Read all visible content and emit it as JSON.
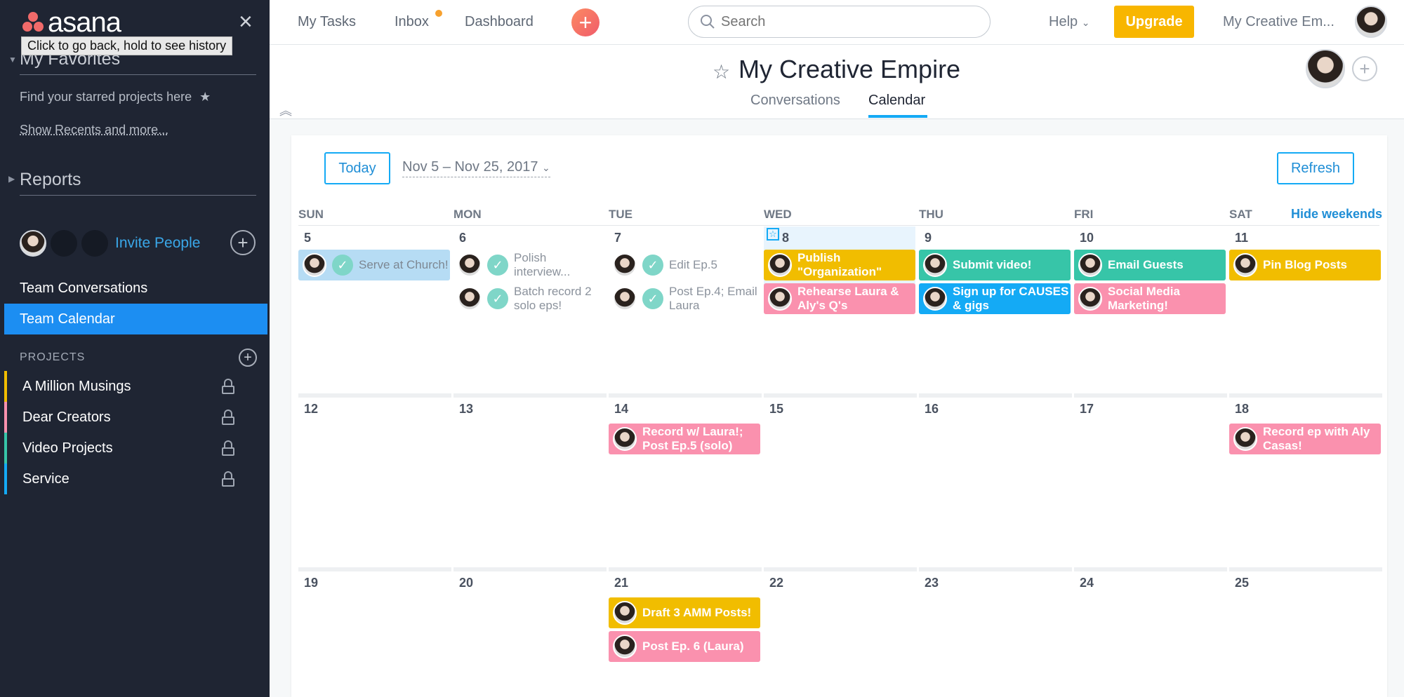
{
  "sidebar": {
    "logo_text": "asana",
    "tooltip": "Click to go back, hold to see history",
    "favorites_title": "My Favorites",
    "favorites_hint": "Find your starred projects here",
    "show_recents": "Show Recents and more...",
    "reports_title": "Reports",
    "invite_people": "Invite People",
    "nav": [
      {
        "label": "Team Conversations"
      },
      {
        "label": "Team Calendar"
      }
    ],
    "projects_title": "PROJECTS",
    "projects": [
      {
        "label": "A Million Musings",
        "color": "#f1bd00"
      },
      {
        "label": "Dear Creators",
        "color": "#fa91ae"
      },
      {
        "label": "Video Projects",
        "color": "#37c5a8"
      },
      {
        "label": "Service",
        "color": "#14aaf5"
      }
    ]
  },
  "topbar": {
    "my_tasks": "My Tasks",
    "inbox": "Inbox",
    "dashboard": "Dashboard",
    "search_placeholder": "Search",
    "help": "Help",
    "upgrade": "Upgrade",
    "workspace": "My Creative Em..."
  },
  "header": {
    "title": "My Creative Empire",
    "tabs": [
      {
        "label": "Conversations"
      },
      {
        "label": "Calendar"
      }
    ]
  },
  "calendar": {
    "today_label": "Today",
    "range_label": "Nov 5 – Nov 25, 2017",
    "refresh_label": "Refresh",
    "hide_weekends": "Hide weekends",
    "days_of_week": [
      "SUN",
      "MON",
      "TUE",
      "WED",
      "THU",
      "FRI",
      "SAT"
    ],
    "weeks": [
      [
        "5",
        "6",
        "7",
        "8",
        "9",
        "10",
        "11"
      ],
      [
        "12",
        "13",
        "14",
        "15",
        "16",
        "17",
        "18"
      ],
      [
        "19",
        "20",
        "21",
        "22",
        "23",
        "24",
        "25"
      ]
    ],
    "tasks": {
      "serve_church": "Serve at Church!",
      "polish_interview": "Polish interview...",
      "batch_record": "Batch record 2 solo eps!",
      "edit_ep5": "Edit Ep.5",
      "post_ep4": "Post Ep.4; Email Laura",
      "publish_org": "Publish \"Organization\"",
      "rehearse": "Rehearse Laura & Aly's Q's",
      "submit_video": "Submit video!",
      "sign_up": "Sign up for CAUSES & gigs",
      "email_guests": "Email Guests",
      "social_media": "Social Media Marketing!",
      "pin_blog": "Pin Blog Posts",
      "record_laura": "Record w/ Laura!; Post Ep.5 (solo)",
      "record_aly": "Record ep with Aly Casas!",
      "draft_amm": "Draft 3 AMM Posts!",
      "post_ep6": "Post Ep. 6 (Laura)"
    }
  }
}
